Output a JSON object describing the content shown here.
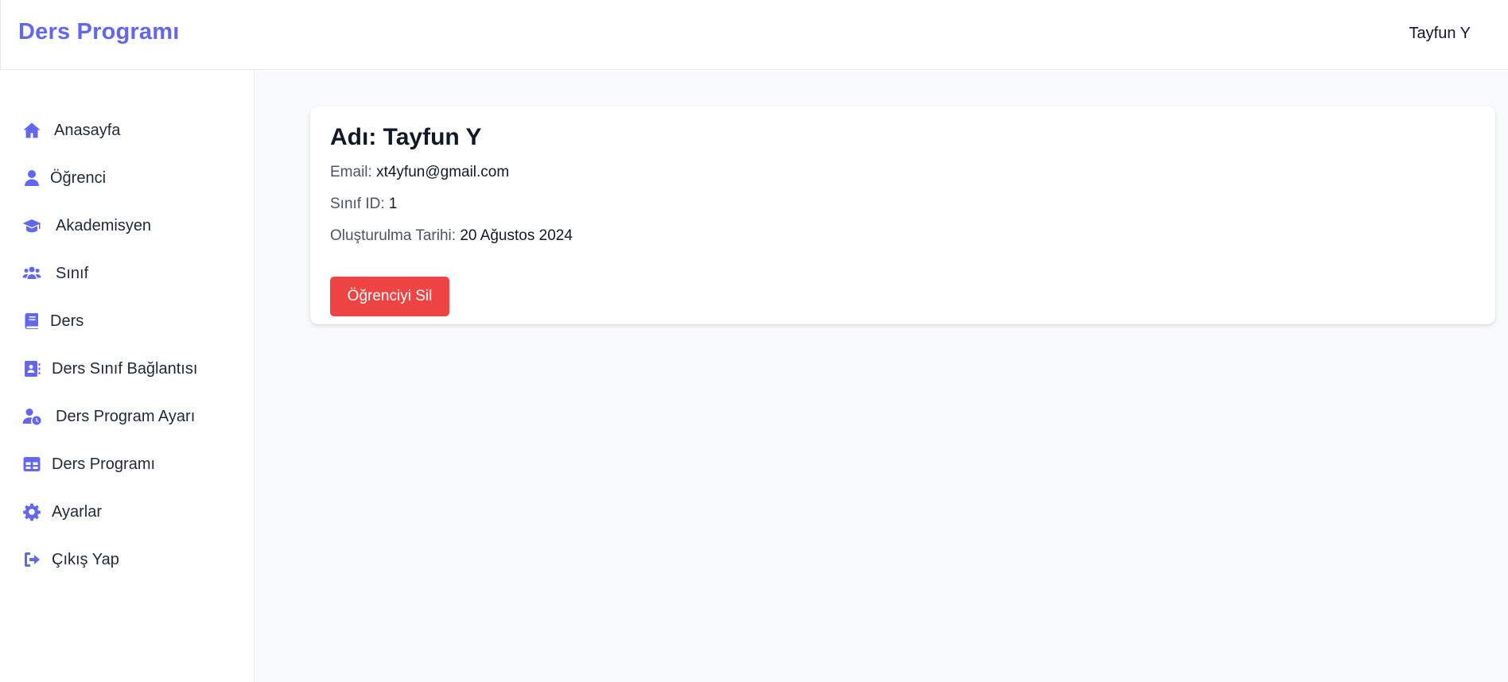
{
  "header": {
    "brand": "Ders Programı",
    "user_name": "Tayfun Y"
  },
  "sidebar": {
    "accent_color": "#6366f1",
    "items": [
      {
        "label": "Anasayfa",
        "icon": "home-icon"
      },
      {
        "label": "Öğrenci",
        "icon": "user-icon"
      },
      {
        "label": "Akademisyen",
        "icon": "graduation-cap-icon"
      },
      {
        "label": "Sınıf",
        "icon": "users-icon"
      },
      {
        "label": "Ders",
        "icon": "book-icon"
      },
      {
        "label": "Ders Sınıf Bağlantısı",
        "icon": "address-book-icon"
      },
      {
        "label": "Ders Program Ayarı",
        "icon": "user-clock-icon"
      },
      {
        "label": "Ders Programı",
        "icon": "table-icon"
      },
      {
        "label": "Ayarlar",
        "icon": "gear-icon"
      },
      {
        "label": "Çıkış Yap",
        "icon": "sign-out-icon"
      }
    ]
  },
  "student": {
    "title": "Adı: Tayfun Y",
    "email_label": "Email:",
    "email_value": "xt4yfun@gmail.com",
    "class_label": "Sınıf ID:",
    "class_value": "1",
    "created_label": "Oluşturulma Tarihi:",
    "created_value": "20 Ağustos 2024",
    "delete_button": "Öğrenciyi Sil",
    "delete_color": "#ef4444"
  }
}
